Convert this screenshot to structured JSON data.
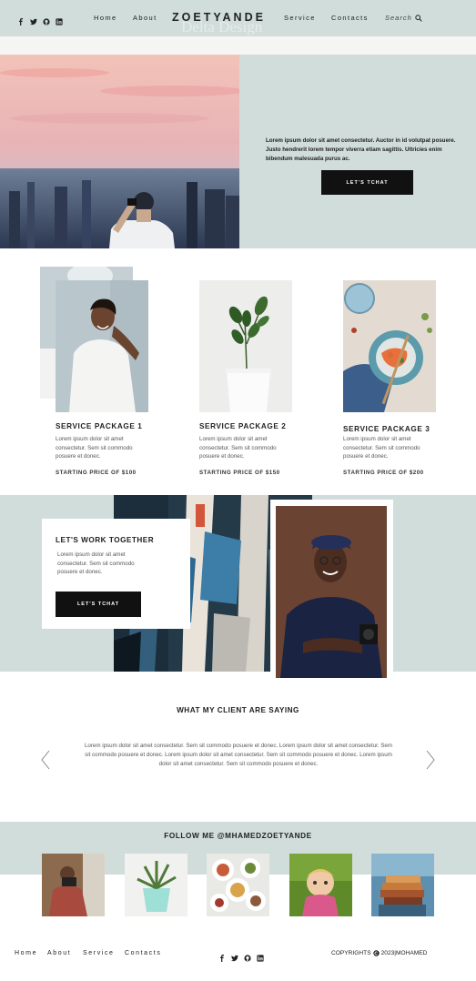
{
  "header": {
    "brand": "ZOETYANDE",
    "ghost_title": "Delta Design",
    "nav_left": [
      "Home",
      "About"
    ],
    "nav_right": [
      "Service",
      "Contacts"
    ],
    "search_label": "Search",
    "social_icons": [
      "facebook-icon",
      "twitter-icon",
      "github-icon",
      "linkedin-icon"
    ]
  },
  "hero": {
    "text": "Lorem ipsum dolor sit amet consectetur. Auctor in id volutpat posuere. Justo hendrerit lorem tempor viverra etiam sagittis. Ultricies enim bibendum malesuada purus ac.",
    "button_label": "LET'S TCHAT"
  },
  "services": [
    {
      "title": "SERVICE  PACKAGE 1",
      "desc": "Lorem ipsum dolor sit amet consectetur. Sem sit commodo posuere et donec.",
      "price": "STARTING PRICE OF  $100"
    },
    {
      "title": "SERVICE  PACKAGE 2",
      "desc": "Lorem ipsum dolor sit amet consectetur. Sem sit commodo posuere et donec.",
      "price": "STARTING PRICE OF  $150"
    },
    {
      "title": "SERVICE  PACKAGE 3",
      "desc": "Lorem ipsum dolor sit amet consectetur. Sem sit commodo posuere et donec.",
      "price": "STARTING PRICE OF  $200"
    }
  ],
  "work": {
    "title": "LET'S WORK TOGETHER",
    "desc": "Lorem ipsum dolor sit amet consectetur. Sem sit commodo posuere et donec.",
    "button_label": "LET'S TCHAT"
  },
  "testimonials": {
    "heading": "WHAT MY CLIENT ARE SAYING",
    "text": "Lorem ipsum dolor sit amet consectetur. Sem sit commodo posuere et donec. Lorem ipsum dolor sit amet consectetur. Sem sit commodo posuere et donec. Lorem ipsum dolor sit amet consectetur. Sem sit commodo posuere et donec. Lorem ipsum dolor sit amet consectetur. Sem sit commodo posuere et donec."
  },
  "follow": {
    "heading": "FOLLOW ME @MHAMEDZOETYANDE"
  },
  "footer": {
    "links": [
      "Home",
      "About",
      "Service",
      "Contacts"
    ],
    "copyright_prefix": "COPYRIGHTS",
    "copyright_suffix": "2023|MOHAMED"
  },
  "colors": {
    "accent": "#d0ddda",
    "dark_button": "#111111"
  }
}
